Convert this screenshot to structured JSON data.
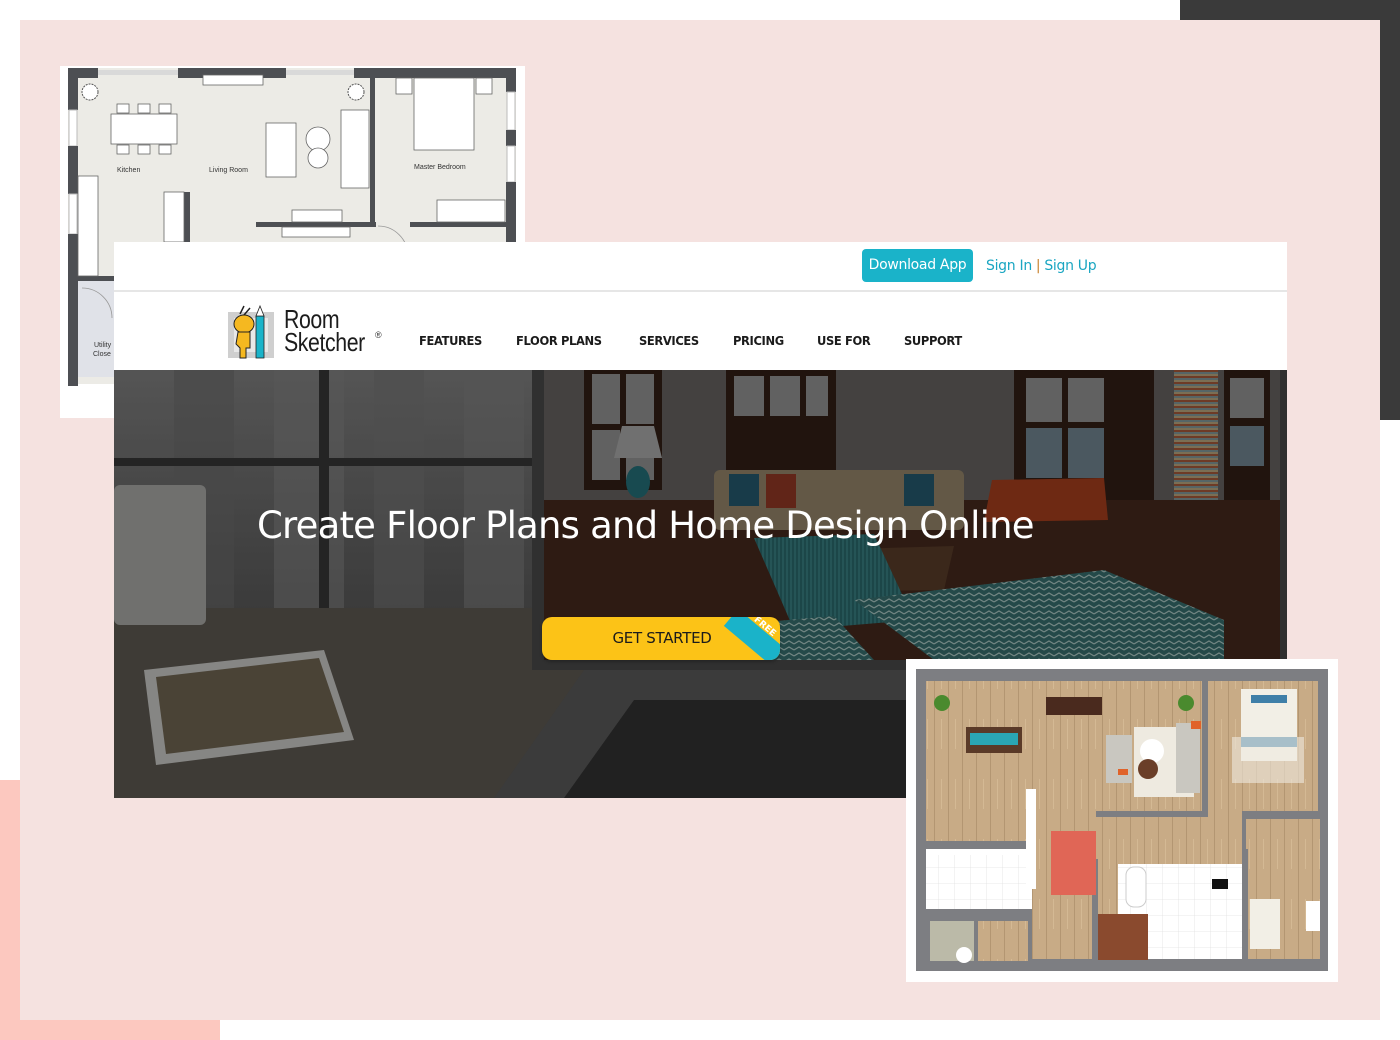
{
  "colors": {
    "background_pink": "#f5e2e0",
    "deco_dark": "#3a3a3a",
    "deco_salmon": "#fcc8bf",
    "brand_teal": "#1ab3c9",
    "cta_yellow": "#fcc317",
    "link_teal": "#1aa6c2",
    "separator_orange": "#c9832e"
  },
  "plan_2d": {
    "rooms": [
      "Kitchen",
      "Living Room",
      "Master Bedroom",
      "Utility",
      "Close"
    ]
  },
  "website": {
    "topbar": {
      "download_label": "Download App",
      "sign_in_label": "Sign In",
      "separator": "|",
      "sign_up_label": "Sign Up"
    },
    "logo": {
      "line1": "Room",
      "line2": "Sketcher",
      "registered": "®",
      "icon": "mascot-with-pencil-icon"
    },
    "nav": [
      {
        "label": "FEATURES"
      },
      {
        "label": "FLOOR PLANS"
      },
      {
        "label": "SERVICES"
      },
      {
        "label": "PRICING"
      },
      {
        "label": "USE FOR"
      },
      {
        "label": "SUPPORT"
      }
    ],
    "hero": {
      "title": "Create Floor Plans and Home Design Online",
      "cta_label": "GET STARTED",
      "cta_badge": "FREE"
    }
  },
  "plan_3d": {
    "description": "3D top-down furnished floor plan"
  }
}
